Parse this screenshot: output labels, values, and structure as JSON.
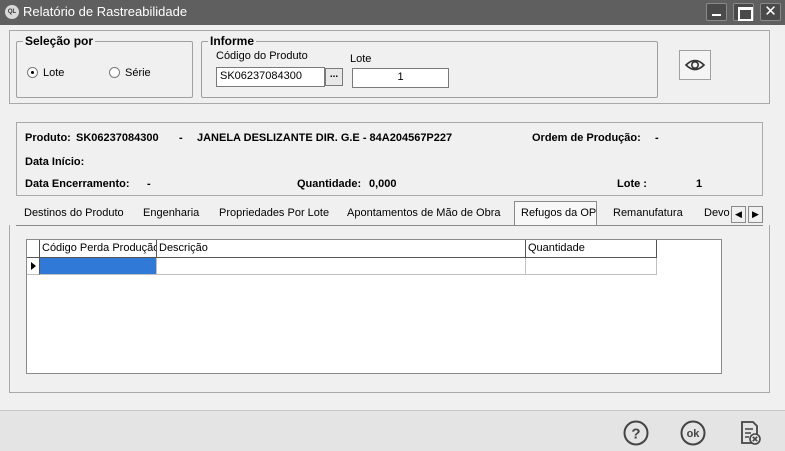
{
  "window": {
    "app_icon_text": "QL",
    "title": "Relatório de Rastreabilidade"
  },
  "selecao": {
    "legend": "Seleção por",
    "options": [
      {
        "label": "Lote",
        "checked": true
      },
      {
        "label": "Série",
        "checked": false
      }
    ]
  },
  "informe": {
    "legend": "Informe",
    "codigo_label": "Código do Produto",
    "codigo_value": "SK06237084300",
    "lookup_label": "...",
    "lote_label": "Lote",
    "lote_value": "1"
  },
  "info": {
    "produto_label": "Produto:",
    "produto_code": "SK06237084300",
    "dash": "-",
    "produto_desc": "JANELA DESLIZANTE DIR. G.E - 84A204567P227",
    "ordem_label": "Ordem de Produção:",
    "ordem_value": "-",
    "data_inicio_label": "Data Início:",
    "data_inicio_value": "",
    "data_enc_label": "Data Encerramento:",
    "data_enc_value": "-",
    "quantidade_label": "Quantidade:",
    "quantidade_value": "0,000",
    "lote_label": "Lote :",
    "lote_value": "1"
  },
  "tabs": [
    {
      "label": "Destinos do Produto"
    },
    {
      "label": "Engenharia"
    },
    {
      "label": "Propriedades Por Lote"
    },
    {
      "label": "Apontamentos de Mão de Obra"
    },
    {
      "label": "Refugos da OP"
    },
    {
      "label": "Remanufatura"
    },
    {
      "label": "Devo"
    }
  ],
  "active_tab": "Refugos da OP",
  "grid": {
    "columns": [
      "Código Perda Produção",
      "Descrição",
      "Quantidade"
    ],
    "rows": [
      [
        "",
        "",
        ""
      ]
    ]
  },
  "footer": {
    "help_icon": "question-circle-icon",
    "ok_icon": "ok-circle-icon",
    "close_icon": "report-close-icon"
  },
  "colors": {
    "titlebar": "#5f5f5f",
    "selection": "#3079d6",
    "background": "#f0f0f0"
  }
}
